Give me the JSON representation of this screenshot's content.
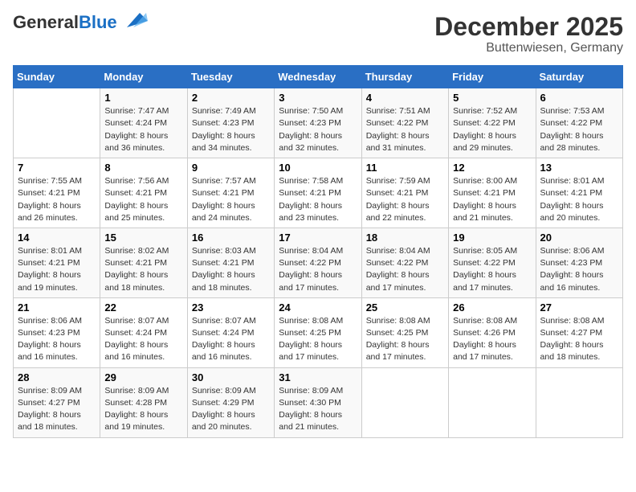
{
  "header": {
    "logo_line1": "General",
    "logo_line2": "Blue",
    "title": "December 2025",
    "subtitle": "Buttenwiesen, Germany"
  },
  "days_of_week": [
    "Sunday",
    "Monday",
    "Tuesday",
    "Wednesday",
    "Thursday",
    "Friday",
    "Saturday"
  ],
  "weeks": [
    [
      {
        "day": null
      },
      {
        "day": 1,
        "sunrise": "7:47 AM",
        "sunset": "4:24 PM",
        "daylight": "8 hours and 36 minutes."
      },
      {
        "day": 2,
        "sunrise": "7:49 AM",
        "sunset": "4:23 PM",
        "daylight": "8 hours and 34 minutes."
      },
      {
        "day": 3,
        "sunrise": "7:50 AM",
        "sunset": "4:23 PM",
        "daylight": "8 hours and 32 minutes."
      },
      {
        "day": 4,
        "sunrise": "7:51 AM",
        "sunset": "4:22 PM",
        "daylight": "8 hours and 31 minutes."
      },
      {
        "day": 5,
        "sunrise": "7:52 AM",
        "sunset": "4:22 PM",
        "daylight": "8 hours and 29 minutes."
      },
      {
        "day": 6,
        "sunrise": "7:53 AM",
        "sunset": "4:22 PM",
        "daylight": "8 hours and 28 minutes."
      }
    ],
    [
      {
        "day": 7,
        "sunrise": "7:55 AM",
        "sunset": "4:21 PM",
        "daylight": "8 hours and 26 minutes."
      },
      {
        "day": 8,
        "sunrise": "7:56 AM",
        "sunset": "4:21 PM",
        "daylight": "8 hours and 25 minutes."
      },
      {
        "day": 9,
        "sunrise": "7:57 AM",
        "sunset": "4:21 PM",
        "daylight": "8 hours and 24 minutes."
      },
      {
        "day": 10,
        "sunrise": "7:58 AM",
        "sunset": "4:21 PM",
        "daylight": "8 hours and 23 minutes."
      },
      {
        "day": 11,
        "sunrise": "7:59 AM",
        "sunset": "4:21 PM",
        "daylight": "8 hours and 22 minutes."
      },
      {
        "day": 12,
        "sunrise": "8:00 AM",
        "sunset": "4:21 PM",
        "daylight": "8 hours and 21 minutes."
      },
      {
        "day": 13,
        "sunrise": "8:01 AM",
        "sunset": "4:21 PM",
        "daylight": "8 hours and 20 minutes."
      }
    ],
    [
      {
        "day": 14,
        "sunrise": "8:01 AM",
        "sunset": "4:21 PM",
        "daylight": "8 hours and 19 minutes."
      },
      {
        "day": 15,
        "sunrise": "8:02 AM",
        "sunset": "4:21 PM",
        "daylight": "8 hours and 18 minutes."
      },
      {
        "day": 16,
        "sunrise": "8:03 AM",
        "sunset": "4:21 PM",
        "daylight": "8 hours and 18 minutes."
      },
      {
        "day": 17,
        "sunrise": "8:04 AM",
        "sunset": "4:22 PM",
        "daylight": "8 hours and 17 minutes."
      },
      {
        "day": 18,
        "sunrise": "8:04 AM",
        "sunset": "4:22 PM",
        "daylight": "8 hours and 17 minutes."
      },
      {
        "day": 19,
        "sunrise": "8:05 AM",
        "sunset": "4:22 PM",
        "daylight": "8 hours and 17 minutes."
      },
      {
        "day": 20,
        "sunrise": "8:06 AM",
        "sunset": "4:23 PM",
        "daylight": "8 hours and 16 minutes."
      }
    ],
    [
      {
        "day": 21,
        "sunrise": "8:06 AM",
        "sunset": "4:23 PM",
        "daylight": "8 hours and 16 minutes."
      },
      {
        "day": 22,
        "sunrise": "8:07 AM",
        "sunset": "4:24 PM",
        "daylight": "8 hours and 16 minutes."
      },
      {
        "day": 23,
        "sunrise": "8:07 AM",
        "sunset": "4:24 PM",
        "daylight": "8 hours and 16 minutes."
      },
      {
        "day": 24,
        "sunrise": "8:08 AM",
        "sunset": "4:25 PM",
        "daylight": "8 hours and 17 minutes."
      },
      {
        "day": 25,
        "sunrise": "8:08 AM",
        "sunset": "4:25 PM",
        "daylight": "8 hours and 17 minutes."
      },
      {
        "day": 26,
        "sunrise": "8:08 AM",
        "sunset": "4:26 PM",
        "daylight": "8 hours and 17 minutes."
      },
      {
        "day": 27,
        "sunrise": "8:08 AM",
        "sunset": "4:27 PM",
        "daylight": "8 hours and 18 minutes."
      }
    ],
    [
      {
        "day": 28,
        "sunrise": "8:09 AM",
        "sunset": "4:27 PM",
        "daylight": "8 hours and 18 minutes."
      },
      {
        "day": 29,
        "sunrise": "8:09 AM",
        "sunset": "4:28 PM",
        "daylight": "8 hours and 19 minutes."
      },
      {
        "day": 30,
        "sunrise": "8:09 AM",
        "sunset": "4:29 PM",
        "daylight": "8 hours and 20 minutes."
      },
      {
        "day": 31,
        "sunrise": "8:09 AM",
        "sunset": "4:30 PM",
        "daylight": "8 hours and 21 minutes."
      },
      {
        "day": null
      },
      {
        "day": null
      },
      {
        "day": null
      }
    ]
  ]
}
